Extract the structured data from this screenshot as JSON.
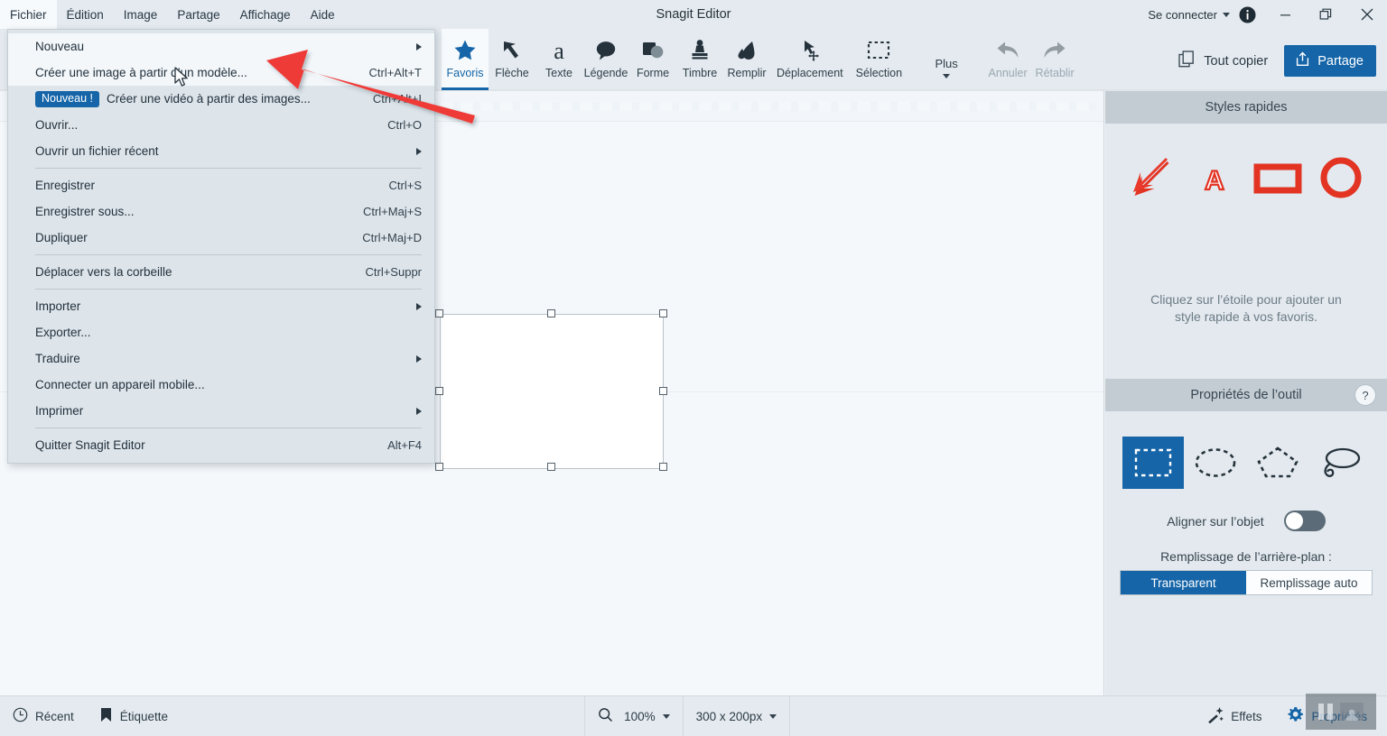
{
  "window": {
    "title": "Snagit Editor",
    "signin_label": "Se connecter",
    "minimize_icon": "minimize-icon",
    "restore_icon": "restore-icon",
    "close_icon": "close-icon",
    "info_icon": "info-icon"
  },
  "menubar": {
    "items": [
      {
        "label": "Fichier",
        "open": true
      },
      {
        "label": "Édition",
        "open": false
      },
      {
        "label": "Image",
        "open": false
      },
      {
        "label": "Partage",
        "open": false
      },
      {
        "label": "Affichage",
        "open": false
      },
      {
        "label": "Aide",
        "open": false
      }
    ]
  },
  "file_menu": {
    "rows": [
      {
        "type": "item",
        "label": "Nouveau",
        "accel": "",
        "submenu": true,
        "highlighted": true,
        "badge": ""
      },
      {
        "type": "item",
        "label": "Créer une image à partir d’un modèle...",
        "accel": "Ctrl+Alt+T",
        "submenu": false,
        "highlighted": true,
        "badge": ""
      },
      {
        "type": "item",
        "label": "Créer une vidéo à partir des images...",
        "accel": "Ctrl+Alt+I",
        "submenu": false,
        "highlighted": false,
        "badge": "Nouveau !"
      },
      {
        "type": "item",
        "label": "Ouvrir...",
        "accel": "Ctrl+O",
        "submenu": false,
        "highlighted": false,
        "badge": ""
      },
      {
        "type": "item",
        "label": "Ouvrir un fichier récent",
        "accel": "",
        "submenu": true,
        "highlighted": false,
        "badge": ""
      },
      {
        "type": "sep"
      },
      {
        "type": "item",
        "label": "Enregistrer",
        "accel": "Ctrl+S",
        "submenu": false,
        "highlighted": false,
        "badge": ""
      },
      {
        "type": "item",
        "label": "Enregistrer sous...",
        "accel": "Ctrl+Maj+S",
        "submenu": false,
        "highlighted": false,
        "badge": ""
      },
      {
        "type": "item",
        "label": "Dupliquer",
        "accel": "Ctrl+Maj+D",
        "submenu": false,
        "highlighted": false,
        "badge": ""
      },
      {
        "type": "sep"
      },
      {
        "type": "item",
        "label": "Déplacer vers la corbeille",
        "accel": "Ctrl+Suppr",
        "submenu": false,
        "highlighted": false,
        "badge": ""
      },
      {
        "type": "sep"
      },
      {
        "type": "item",
        "label": "Importer",
        "accel": "",
        "submenu": true,
        "highlighted": false,
        "badge": ""
      },
      {
        "type": "item",
        "label": "Exporter...",
        "accel": "",
        "submenu": false,
        "highlighted": false,
        "badge": ""
      },
      {
        "type": "item",
        "label": "Traduire",
        "accel": "",
        "submenu": true,
        "highlighted": false,
        "badge": ""
      },
      {
        "type": "item",
        "label": "Connecter un appareil mobile...",
        "accel": "",
        "submenu": false,
        "highlighted": false,
        "badge": ""
      },
      {
        "type": "item",
        "label": "Imprimer",
        "accel": "",
        "submenu": true,
        "highlighted": false,
        "badge": ""
      },
      {
        "type": "sep"
      },
      {
        "type": "item",
        "label": "Quitter Snagit Editor",
        "accel": "Alt+F4",
        "submenu": false,
        "highlighted": false,
        "badge": ""
      }
    ]
  },
  "toolbar": {
    "tools": [
      {
        "label": "Favoris",
        "icon": "star-icon",
        "active": true,
        "disabled": false
      },
      {
        "label": "Flèche",
        "icon": "arrow-icon",
        "active": false,
        "disabled": false
      },
      {
        "label": "Texte",
        "icon": "text-icon",
        "active": false,
        "disabled": false
      },
      {
        "label": "Légende",
        "icon": "callout-icon",
        "active": false,
        "disabled": false
      },
      {
        "label": "Forme",
        "icon": "shape-icon",
        "active": false,
        "disabled": false
      },
      {
        "label": "Timbre",
        "icon": "stamp-icon",
        "active": false,
        "disabled": false
      },
      {
        "label": "Remplir",
        "icon": "fill-icon",
        "active": false,
        "disabled": false
      },
      {
        "label": "Déplacement",
        "icon": "move-icon",
        "active": false,
        "disabled": false
      },
      {
        "label": "Sélection",
        "icon": "selection-icon",
        "active": false,
        "disabled": false
      },
      {
        "label": "Plus",
        "icon": "more-icon",
        "active": false,
        "disabled": false
      },
      {
        "label": "Annuler",
        "icon": "undo-icon",
        "active": false,
        "disabled": true
      },
      {
        "label": "Rétablir",
        "icon": "redo-icon",
        "active": false,
        "disabled": true
      }
    ],
    "copy_all_label": "Tout copier",
    "copy_all_icon": "copy-icon",
    "share_label": "Partage",
    "share_icon": "share-icon",
    "accent_color": "#1565a8"
  },
  "canvas": {
    "object_selected": true,
    "handles": 8
  },
  "quick_styles": {
    "header": "Styles rapides",
    "items": [
      {
        "icon": "red-arrow-style",
        "color": "#e23323"
      },
      {
        "icon": "red-letter-a-style",
        "color": "#e23323"
      },
      {
        "icon": "red-rectangle-style",
        "color": "#e23323"
      },
      {
        "icon": "red-circle-style",
        "color": "#e23323"
      }
    ],
    "hint_line1": "Cliquez sur l’étoile pour ajouter un",
    "hint_line2": "style rapide à vos favoris."
  },
  "tool_properties": {
    "header": "Propriétés de l’outil",
    "help_label": "?",
    "shapes": [
      {
        "icon": "rectangle-selection-icon",
        "selected": true
      },
      {
        "icon": "ellipse-selection-icon",
        "selected": false
      },
      {
        "icon": "polygon-selection-icon",
        "selected": false
      },
      {
        "icon": "lasso-selection-icon",
        "selected": false
      }
    ],
    "snap_label": "Aligner sur l’objet",
    "snap_on": false,
    "fill_label": "Remplissage de l’arrière-plan :",
    "fill_options": [
      {
        "label": "Transparent",
        "selected": true
      },
      {
        "label": "Remplissage auto",
        "selected": false
      }
    ]
  },
  "statusbar": {
    "recent_label": "Récent",
    "recent_icon": "clock-icon",
    "tag_label": "Étiquette",
    "tag_icon": "tag-icon",
    "zoom_icon": "magnifier-icon",
    "zoom_value": "100%",
    "size_value": "300 x 200px",
    "effects_label": "Effets",
    "effects_icon": "magic-wand-icon",
    "properties_label": "Propriétés",
    "properties_icon": "gear-icon"
  },
  "recording_widget": {
    "pause_icon": "pause-icon",
    "webcam_icon": "webcam-icon"
  },
  "annotation": {
    "arrow_color": "#ef3b37",
    "arrow_from": "525,128",
    "arrow_to": "300,67"
  }
}
